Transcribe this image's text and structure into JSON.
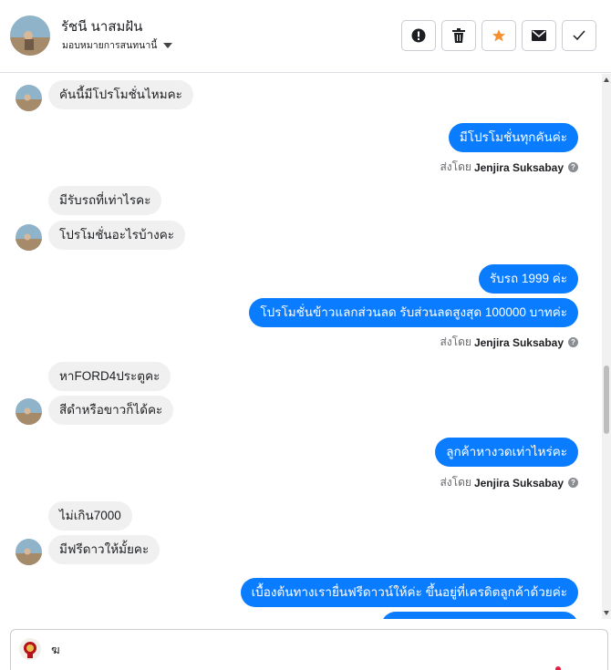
{
  "header": {
    "contact_name": "รัชนี นาสมฝัน",
    "assign_label": "มอบหมายการสนทนานี้",
    "actions": [
      {
        "name": "mark-spam-button",
        "icon": "exclamation-icon"
      },
      {
        "name": "delete-button",
        "icon": "trash-icon"
      },
      {
        "name": "star-button",
        "icon": "star-icon"
      },
      {
        "name": "mark-unread-button",
        "icon": "envelope-icon"
      },
      {
        "name": "mark-done-button",
        "icon": "check-icon"
      }
    ]
  },
  "colors": {
    "outgoing_bubble": "#0a7cff",
    "incoming_bubble": "#f0f0f0",
    "star": "#f4902f",
    "text_muted": "#65676b"
  },
  "messages": {
    "m1": "คันนี้มีโปรโมชั่นไหมคะ",
    "m2": "มีโปรโมชั่นทุกคันค่ะ",
    "m3": "มีรับรถที่เท่าไรคะ",
    "m4": "โปรโมชั่นอะไรบ้างคะ",
    "m5": "รับรถ 1999 ค่ะ",
    "m6": "โปรโมชั่นข้าวแลกส่วนลด รับส่วนลดสูงสุด 100000 บาทค่ะ",
    "m7": "หาFORD4ประตูคะ",
    "m8": "สีดำหรือขาวก็ได้คะ",
    "m9": "ลูกค้าหางวดเท่าไหร่คะ",
    "m10": "ไม่เกิน7000",
    "m11": "มีฟรีดาวให้มั้ยคะ",
    "m12": "เบื้องต้นทางเรายื่นฟรีดาวน์ให้ค่ะ ขึ้นอยู่ที่เครดิตลูกค้าด้วยค่ะ"
  },
  "sent_by": {
    "prefix": "ส่งโดย",
    "agent": "Jenjira Suksabay"
  },
  "composer": {
    "value": "ฆ"
  }
}
